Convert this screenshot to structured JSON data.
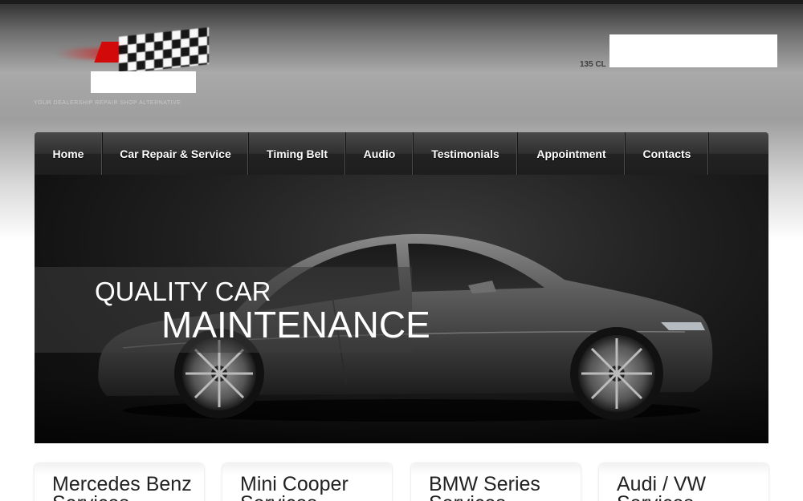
{
  "header": {
    "tagline": "YOUR DEALERSHIP REPAIR SHOP ALTERNATIVE",
    "address": "135 CL"
  },
  "nav": {
    "items": [
      {
        "label": "Home"
      },
      {
        "label": "Car Repair & Service"
      },
      {
        "label": "Timing Belt"
      },
      {
        "label": "Audio"
      },
      {
        "label": "Testimonials"
      },
      {
        "label": "Appointment"
      },
      {
        "label": "Contacts"
      }
    ]
  },
  "hero": {
    "line1": "QUALITY CAR",
    "line2": "MAINTENANCE"
  },
  "services": [
    {
      "title": "Mercedes Benz Services"
    },
    {
      "title": "Mini Cooper Services"
    },
    {
      "title": "BMW Series Services"
    },
    {
      "title": "Audi / VW Services"
    }
  ],
  "colors": {
    "nav_bg": "#2a2a2a",
    "hero_bg": "#151515",
    "logo_red": "#d20a0a"
  }
}
